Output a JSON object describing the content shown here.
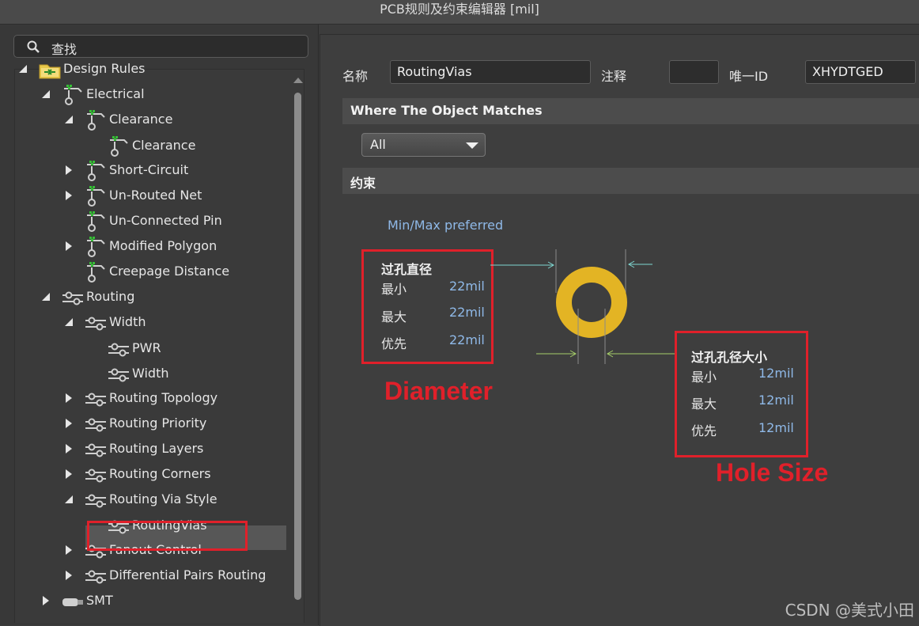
{
  "window": {
    "title": "PCB规则及约束编辑器 [mil]"
  },
  "search": {
    "label": "查找",
    "icon": "search-icon"
  },
  "tree": {
    "items": [
      {
        "label": "Design Rules",
        "expanded": true,
        "icon": "folder-icon"
      },
      {
        "label": "Electrical",
        "expanded": true,
        "icon": "electrical-rule-icon"
      },
      {
        "label": "Clearance",
        "expanded": true,
        "icon": "electrical-rule-icon"
      },
      {
        "label": "Clearance",
        "icon": "electrical-rule-icon"
      },
      {
        "label": "Short-Circuit",
        "expanded": false,
        "icon": "electrical-rule-icon"
      },
      {
        "label": "Un-Routed Net",
        "expanded": false,
        "icon": "electrical-rule-icon"
      },
      {
        "label": "Un-Connected Pin",
        "icon": "electrical-rule-icon"
      },
      {
        "label": "Modified Polygon",
        "expanded": false,
        "icon": "electrical-rule-icon"
      },
      {
        "label": "Creepage Distance",
        "icon": "electrical-rule-icon"
      },
      {
        "label": "Routing",
        "expanded": true,
        "icon": "routing-rule-icon"
      },
      {
        "label": "Width",
        "expanded": true,
        "icon": "routing-rule-icon"
      },
      {
        "label": "PWR",
        "icon": "routing-rule-icon"
      },
      {
        "label": "Width",
        "icon": "routing-rule-icon"
      },
      {
        "label": "Routing Topology",
        "expanded": false,
        "icon": "routing-rule-icon"
      },
      {
        "label": "Routing Priority",
        "expanded": false,
        "icon": "routing-rule-icon"
      },
      {
        "label": "Routing Layers",
        "expanded": false,
        "icon": "routing-rule-icon"
      },
      {
        "label": "Routing Corners",
        "expanded": false,
        "icon": "routing-rule-icon"
      },
      {
        "label": "Routing Via Style",
        "expanded": true,
        "icon": "routing-rule-icon"
      },
      {
        "label": "RoutingVias",
        "selected": true,
        "icon": "routing-rule-icon"
      },
      {
        "label": "Fanout Control",
        "expanded": false,
        "icon": "routing-rule-icon"
      },
      {
        "label": "Differential Pairs Routing",
        "expanded": false,
        "icon": "routing-rule-icon"
      },
      {
        "label": "SMT",
        "expanded": false,
        "icon": "smt-rule-icon"
      }
    ]
  },
  "rule": {
    "name_label": "名称",
    "name_value": "RoutingVias",
    "comment_label": "注释",
    "comment_value": "",
    "id_label": "唯一ID",
    "id_value": "XHYDTGED"
  },
  "where": {
    "header": "Where The Object Matches",
    "selected_option": "All"
  },
  "constraints": {
    "header": "约束",
    "mode_label": "Min/Max preferred",
    "via_diameter": {
      "title": "过孔直径",
      "rows": [
        {
          "label": "最小",
          "value": "22mil"
        },
        {
          "label": "最大",
          "value": "22mil"
        },
        {
          "label": "优先",
          "value": "22mil"
        }
      ]
    },
    "hole_size": {
      "title": "过孔孔径大小",
      "rows": [
        {
          "label": "最小",
          "value": "12mil"
        },
        {
          "label": "最大",
          "value": "12mil"
        },
        {
          "label": "优先",
          "value": "12mil"
        }
      ]
    }
  },
  "annotations": {
    "diameter": "Diameter",
    "hole_size": "Hole Size",
    "highlight_color": "#e0202a"
  },
  "colors": {
    "via_ring": "#e3b424",
    "dimension_line_cyan": "#7fd6d0",
    "dimension_line_green": "#a6cf6a"
  },
  "watermark": "CSDN @美式小田"
}
